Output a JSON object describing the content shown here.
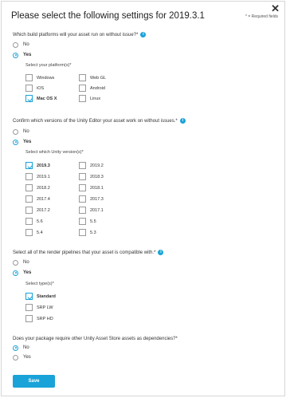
{
  "dialog": {
    "title": "Please select the following settings for 2019.3.1",
    "required_note": "* = Required fields",
    "close_glyph": "✕",
    "info_glyph": "i",
    "accent_color": "#1aa3d9"
  },
  "q1": {
    "question": "Which build platforms will your asset run on without issue?*",
    "options": [
      "No",
      "Yes"
    ],
    "selected": "Yes",
    "sub_label": "Select your platform(s)*",
    "platforms": [
      {
        "label": "Windows",
        "checked": false
      },
      {
        "label": "Web GL",
        "checked": false
      },
      {
        "label": "iOS",
        "checked": false
      },
      {
        "label": "Android",
        "checked": false
      },
      {
        "label": "Mac OS X",
        "checked": true
      },
      {
        "label": "Linux",
        "checked": false
      }
    ]
  },
  "q2": {
    "question": "Confirm which versions of the Unity Editor your asset work on without issues.*",
    "options": [
      "No",
      "Yes"
    ],
    "selected": "Yes",
    "sub_label": "Select which Unity version(s)*",
    "versions": [
      {
        "label": "2019.3",
        "checked": true
      },
      {
        "label": "2019.2",
        "checked": false
      },
      {
        "label": "2019.1",
        "checked": false
      },
      {
        "label": "2018.3",
        "checked": false
      },
      {
        "label": "2018.2",
        "checked": false
      },
      {
        "label": "2018.1",
        "checked": false
      },
      {
        "label": "2017.4",
        "checked": false
      },
      {
        "label": "2017.3",
        "checked": false
      },
      {
        "label": "2017.2",
        "checked": false
      },
      {
        "label": "2017.1",
        "checked": false
      },
      {
        "label": "5.6",
        "checked": false
      },
      {
        "label": "5.5",
        "checked": false
      },
      {
        "label": "5.4",
        "checked": false
      },
      {
        "label": "5.3",
        "checked": false
      }
    ]
  },
  "q3": {
    "question": "Select all of the render pipelines that your asset is compatible with.*",
    "options": [
      "No",
      "Yes"
    ],
    "selected": "Yes",
    "sub_label": "Select type(s)*",
    "types": [
      {
        "label": "Standard",
        "checked": true
      },
      {
        "label": "SRP LW",
        "checked": false
      },
      {
        "label": "SRP HD",
        "checked": false
      }
    ]
  },
  "q4": {
    "question": "Does your package require other Unity Asset Store assets as dependencies?*",
    "options": [
      "No",
      "Yes"
    ],
    "selected": "No"
  },
  "save_label": "Save"
}
